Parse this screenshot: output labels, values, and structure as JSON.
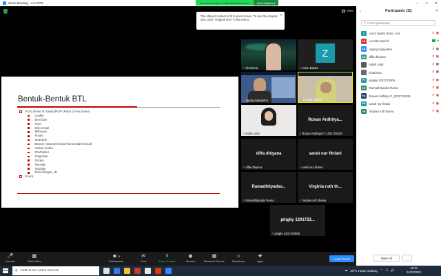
{
  "window": {
    "title": "Zoom Meeting - A4-VR75"
  },
  "banner": {
    "message": "You are viewing Leonita Syarief's screen",
    "options_label": "View Options ▾"
  },
  "view_button": {
    "label": "View"
  },
  "tooltip": {
    "text": "The shared content is fit to your screen. To see the original size, click \"Original size\" in the menu."
  },
  "slide": {
    "title": "Bentuk-Bentuk BTL",
    "main_bullet": "POS (Point of Sales)/POP (Point of Purchase)",
    "sub_items": [
      "Leaflet",
      "Brochure",
      "Flyer",
      "Direct Mail",
      "Billboard",
      "Poster",
      "Spanduk",
      "Banner (Standee/Giant/Horizontal/Vertical)",
      "Umbul-umbul",
      "Shelftalker",
      "Flagchain",
      "Sticker",
      "Neosign",
      "Signage",
      "Panel Brigde, dll"
    ],
    "last_bullet": "Event"
  },
  "tiles": [
    {
      "name": "Kharisma"
    },
    {
      "name": "zoom baa04",
      "initial": "Z"
    },
    {
      "name": "Agung supriyatna"
    },
    {
      "name": "Leonita Syarief"
    },
    {
      "name": "indah catur"
    },
    {
      "name": "Ronan Ardhitya P_1201703029",
      "center": "Ronan Ardhitya..."
    },
    {
      "name": "diffa dhiyana",
      "center": "diffa dhiyana"
    },
    {
      "name": "sarah nur fitriani",
      "center": "sarah nur fitriani"
    },
    {
      "name": "Ramadhityadsv Rama",
      "center": "Ramadhityadsv..."
    },
    {
      "name": "Virginia ruth thania",
      "center": "Virginia ruth th..."
    },
    {
      "name": "pingky 1201723006",
      "center": "pingky 1201723..."
    }
  ],
  "panel": {
    "title": "Participants (11)",
    "search_placeholder": "Find a participant",
    "mute_all": "Mute All",
    "more": "...",
    "participants": [
      {
        "initials": "Z",
        "name": "zoom baa04 (Host, me)",
        "color": "#1b9aaa"
      },
      {
        "initials": "LS",
        "name": "Leonita Syarief",
        "color": "#d13b3b"
      },
      {
        "initials": "AS",
        "name": "Agung supriyatna",
        "color": "#2d8cff"
      },
      {
        "initials": "DD",
        "name": "diffa dhiyana",
        "color": "#2a9d8f"
      },
      {
        "initials": "",
        "name": "indah catur",
        "color": "#5a5a5a"
      },
      {
        "initials": "",
        "name": "Kharisma",
        "color": "#6b6b6b"
      },
      {
        "initials": "P1",
        "name": "pingky 1201723006",
        "color": "#1b9aaa"
      },
      {
        "initials": "RR",
        "name": "Ramadhityadsv Rama",
        "color": "#2b8a5b"
      },
      {
        "initials": "RA",
        "name": "Ronan Ardhitya P_1201703029",
        "color": "#2c3e60"
      },
      {
        "initials": "SN",
        "name": "sarah nur fitriani",
        "color": "#1b9aaa"
      },
      {
        "initials": "VR",
        "name": "Virginia ruth thania",
        "color": "#2b8a5b"
      }
    ]
  },
  "toolbar": {
    "unmute": "Unmute",
    "start_video": "Start Video",
    "participants": "Participants",
    "participants_count": "11",
    "chat": "Chat",
    "share_screen": "Share Screen",
    "record": "Record",
    "breakout": "Breakout Rooms",
    "reactions": "Reactions",
    "apps": "Apps",
    "leave": "Leave Room"
  },
  "taskbar": {
    "search_placeholder": "Ketik di sini untuk mencari",
    "weather": "29°C  Hujan sedang",
    "time": "19:16",
    "date": "24/03/2022"
  }
}
